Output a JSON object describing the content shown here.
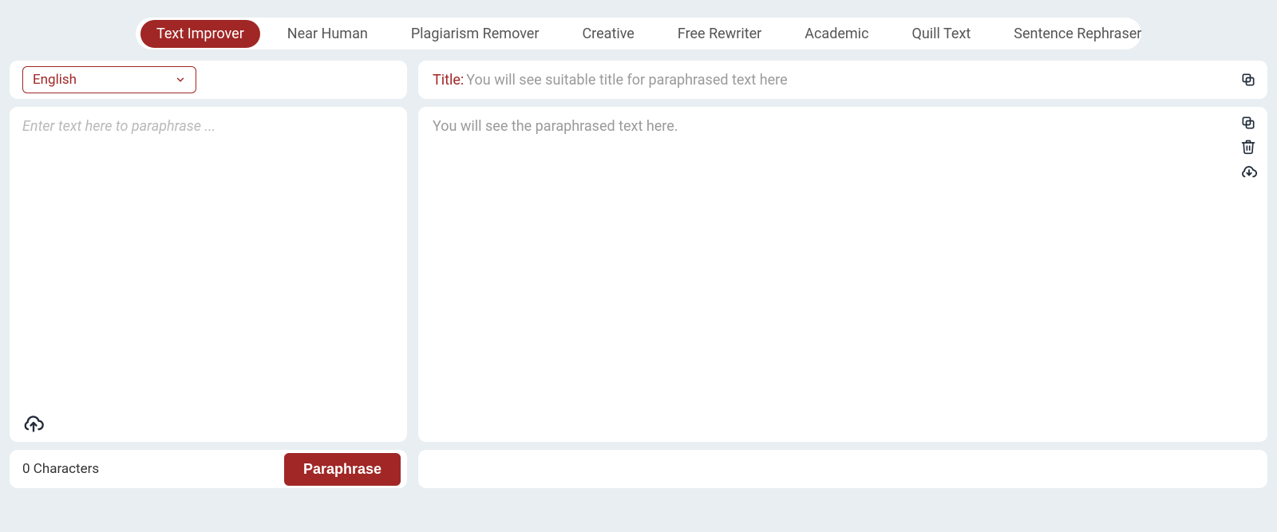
{
  "tabs": [
    {
      "label": "Text Improver",
      "active": true
    },
    {
      "label": "Near Human",
      "active": false
    },
    {
      "label": "Plagiarism Remover",
      "active": false
    },
    {
      "label": "Creative",
      "active": false
    },
    {
      "label": "Free Rewriter",
      "active": false
    },
    {
      "label": "Academic",
      "active": false
    },
    {
      "label": "Quill Text",
      "active": false
    },
    {
      "label": "Sentence Rephraser",
      "active": false
    }
  ],
  "left": {
    "language": "English",
    "input_placeholder": "Enter text here to paraphrase ...",
    "char_count": "0 Characters",
    "paraphrase_label": "Paraphrase"
  },
  "right": {
    "title_label": "Title: ",
    "title_placeholder": "You will see suitable title for paraphrased text here",
    "output_placeholder": "You will see the paraphrased text here."
  },
  "colors": {
    "accent": "#a02725",
    "bg": "#e8eef2"
  }
}
